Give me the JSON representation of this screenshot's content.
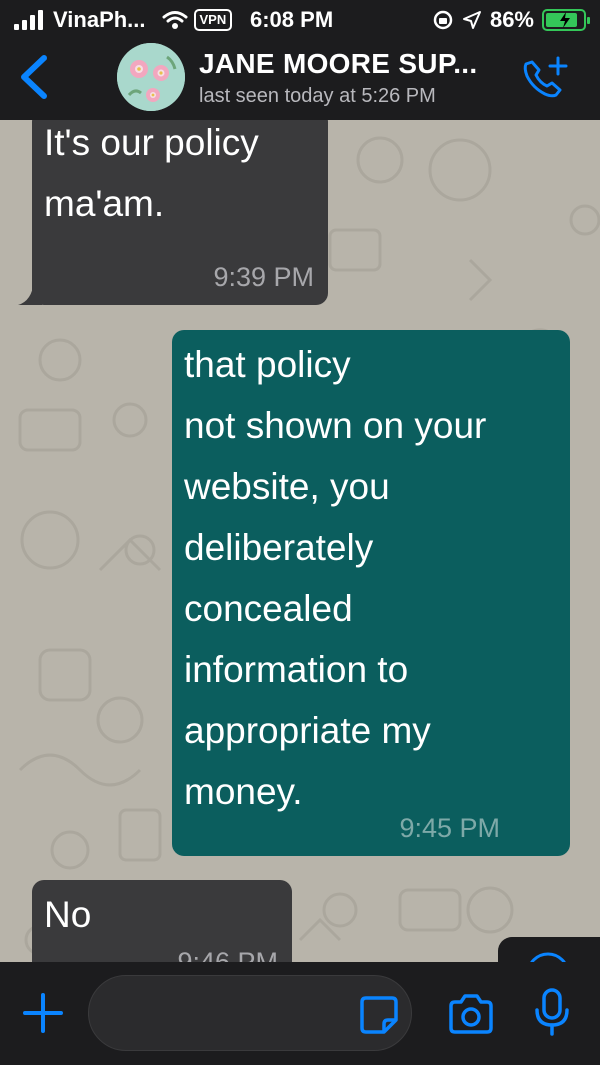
{
  "status_bar": {
    "carrier": "VinaPh...",
    "vpn_label": "VPN",
    "time": "6:08 PM",
    "battery_percent": "86%",
    "battery_level": 0.86
  },
  "header": {
    "contact_name": "JANE MOORE SUP...",
    "last_seen": "last seen today at 5:26 PM"
  },
  "messages": [
    {
      "direction": "incoming",
      "lines": [
        "It's our policy",
        "ma'am."
      ],
      "time": "9:39 PM"
    },
    {
      "direction": "outgoing",
      "lines": [
        "that policy",
        "not shown on your",
        "website, you",
        "deliberately",
        "concealed",
        "information to",
        "appropriate my",
        "money."
      ],
      "time": "9:45 PM"
    },
    {
      "direction": "incoming",
      "lines": [
        "No"
      ],
      "time": "9:46 PM"
    }
  ],
  "input": {
    "placeholder": ""
  },
  "colors": {
    "accent": "#0a84ff",
    "incoming_bubble": "#3a3a3c",
    "outgoing_bubble": "#0b5e5e",
    "wallpaper": "#b8b4aa",
    "battery": "#34c759"
  },
  "icons": [
    "back-chevron-icon",
    "audio-call-add-icon",
    "scroll-down-icon",
    "plus-icon",
    "sticker-icon",
    "camera-icon",
    "microphone-icon",
    "wifi-icon",
    "location-arrow-icon",
    "orientation-lock-icon"
  ]
}
